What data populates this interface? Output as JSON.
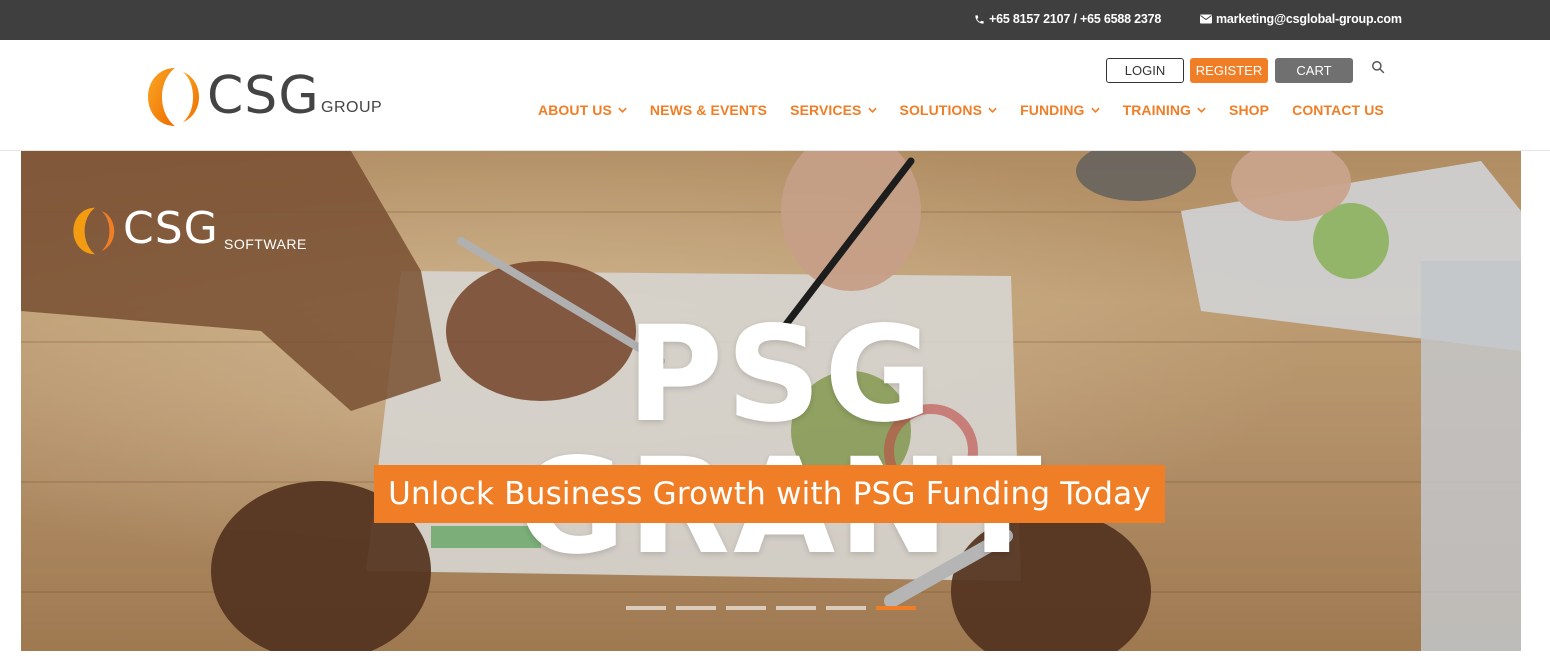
{
  "topbar": {
    "phone": "+65 8157 2107 / +65 6588 2378",
    "email": "marketing@csglobal-group.com"
  },
  "header": {
    "logo": {
      "mark": "CSG",
      "suffix": "GROUP"
    },
    "auth": {
      "login": "LOGIN",
      "register": "REGISTER",
      "cart": "CART"
    },
    "nav": [
      {
        "label": "ABOUT US",
        "dropdown": true
      },
      {
        "label": "NEWS & EVENTS",
        "dropdown": false
      },
      {
        "label": "SERVICES",
        "dropdown": true
      },
      {
        "label": "SOLUTIONS",
        "dropdown": true
      },
      {
        "label": "FUNDING",
        "dropdown": true
      },
      {
        "label": "TRAINING",
        "dropdown": true
      },
      {
        "label": "SHOP",
        "dropdown": false
      },
      {
        "label": "CONTACT US",
        "dropdown": false
      }
    ]
  },
  "hero": {
    "logo": {
      "mark": "CSG",
      "suffix": "SOFTWARE"
    },
    "title": "PSG GRANT",
    "subtitle": "Unlock Business Growth with PSG Funding Today",
    "slides": 6,
    "active_slide": 6
  },
  "colors": {
    "accent": "#f07e26",
    "topbar": "#3f3f3f",
    "cart": "#707070"
  },
  "icons": [
    "phone-icon",
    "mail-icon",
    "search-icon",
    "chevron-down-icon"
  ]
}
